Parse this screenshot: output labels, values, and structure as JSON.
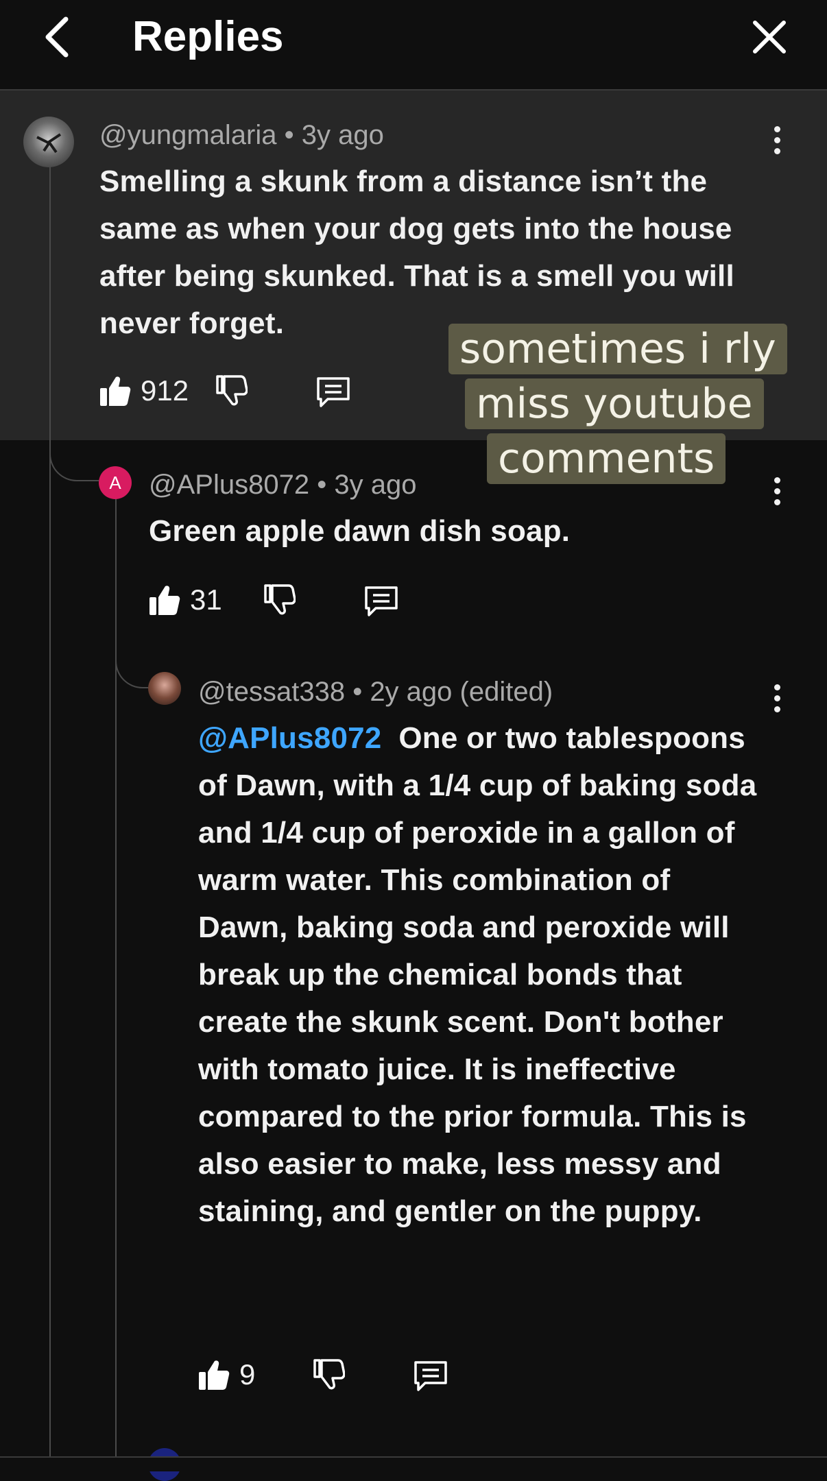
{
  "header": {
    "title": "Replies"
  },
  "comments": [
    {
      "author": "@yungmalaria",
      "time": "3y ago",
      "text": "Smelling a skunk from a distance isn’t the same as when your dog gets into the house after being skunked. That is a smell you will never forget.",
      "likes": "912"
    },
    {
      "author": "@APlus8072",
      "time": "3y ago",
      "avatar_letter": "A",
      "text": "Green apple dawn dish soap.",
      "likes": "31"
    },
    {
      "author": "@tessat338",
      "time": "2y ago (edited)",
      "mention": "@APlus8072",
      "text": "One or two tablespoons of Dawn, with a 1/4 cup of baking soda and 1/4 cup of peroxide in a gallon of warm water.  This combination of Dawn, baking soda and peroxide will break up the chemical bonds that create the skunk scent.  Don't bother with tomato juice.  It is ineffective compared to the prior formula.  This is also easier to make, less messy and staining, and gentler on the puppy.",
      "likes": "9"
    }
  ],
  "overlay_caption": {
    "lines": [
      "sometimes i rly",
      "miss youtube",
      "comments"
    ]
  },
  "colors": {
    "background": "#0f0f0f",
    "highlight": "#272727",
    "mention": "#3ea6ff",
    "avatar_a": "#d81b60"
  },
  "icons": [
    "back-arrow-icon",
    "close-icon",
    "like-icon",
    "dislike-icon",
    "reply-icon",
    "more-vert-icon"
  ]
}
